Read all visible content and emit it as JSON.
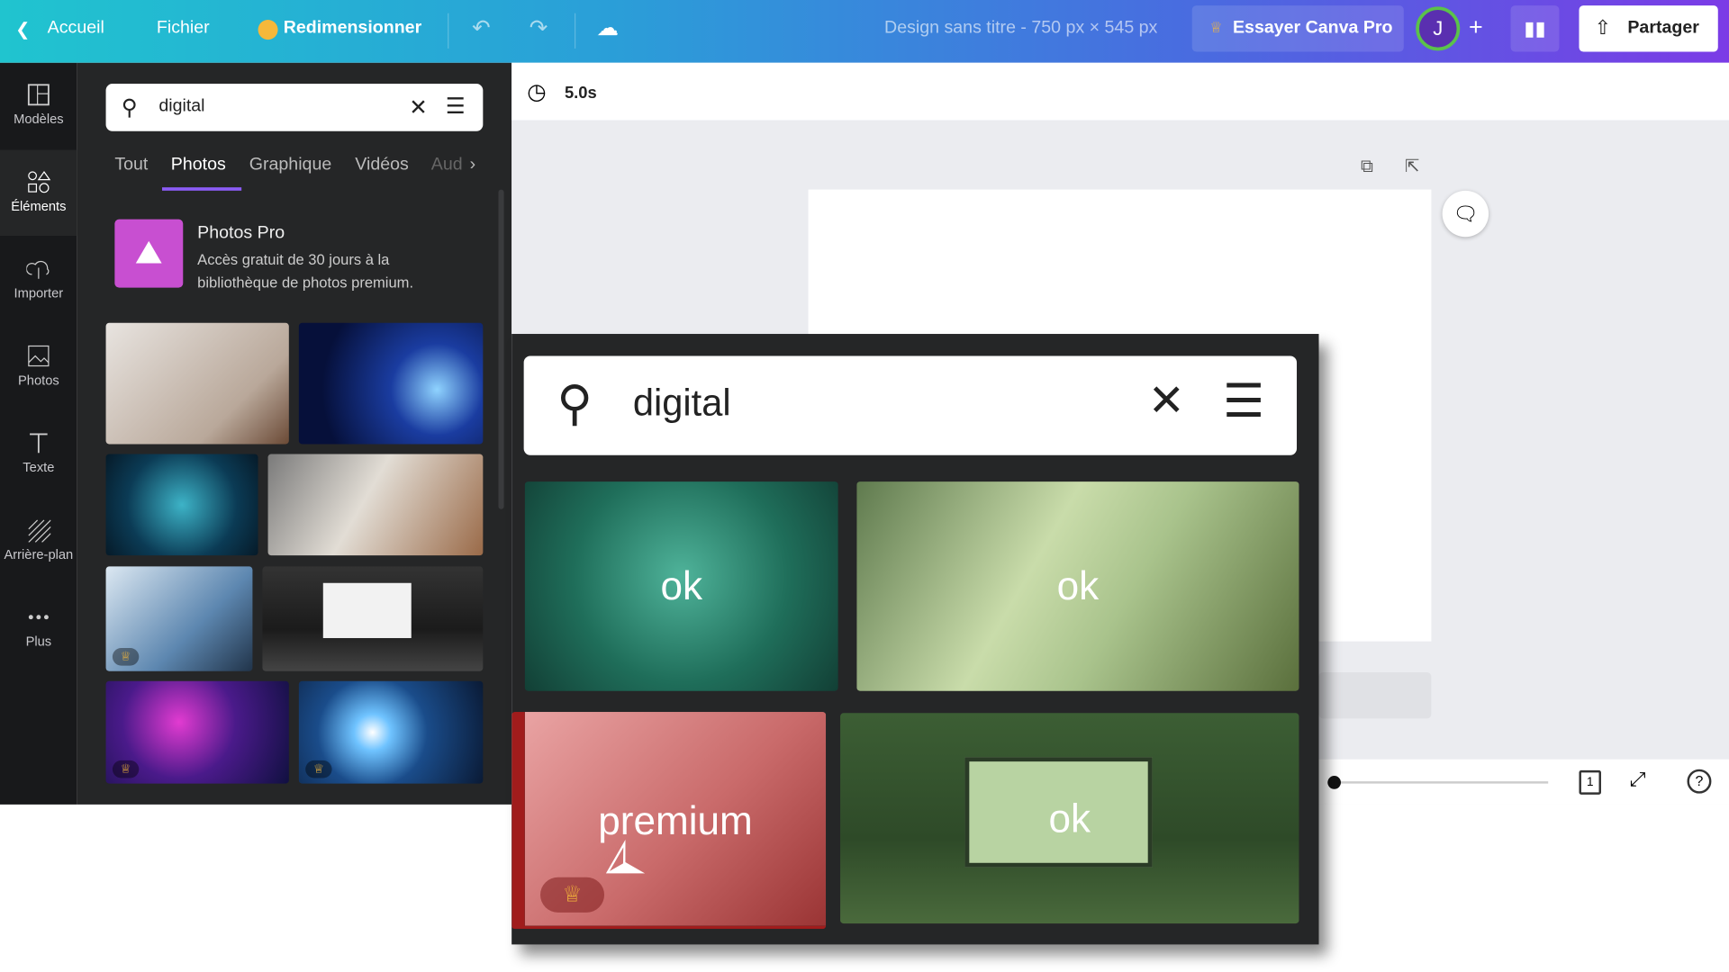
{
  "topbar": {
    "back": "Accueil",
    "file": "Fichier",
    "resize": "Redimensionner",
    "design_title": "Design sans titre - 750 px × 545 px",
    "try_pro": "Essayer Canva Pro",
    "avatar": "J",
    "share": "Partager"
  },
  "sidebar": {
    "items": [
      {
        "label": "Modèles",
        "icon": "templates-icon"
      },
      {
        "label": "Éléments",
        "icon": "elements-icon"
      },
      {
        "label": "Importer",
        "icon": "upload-icon"
      },
      {
        "label": "Photos",
        "icon": "photos-icon"
      },
      {
        "label": "Texte",
        "icon": "text-icon"
      },
      {
        "label": "Arrière-plan",
        "icon": "background-icon"
      },
      {
        "label": "Plus",
        "icon": "more-icon"
      }
    ]
  },
  "panel": {
    "search_value": "digital",
    "tabs": [
      "Tout",
      "Photos",
      "Graphique",
      "Vidéos",
      "Audio"
    ],
    "active_tab": "Photos",
    "promo_title": "Photos Pro",
    "promo_text": "Accès gratuit de 30 jours à la bibliothèque de photos premium."
  },
  "editor": {
    "duration": "5.0s",
    "page_number": "1"
  },
  "overlay": {
    "search_value": "digital",
    "labels": [
      "ok",
      "ok",
      "premium",
      "ok"
    ]
  },
  "colors": {
    "accent": "#8b5cf6",
    "pro_purple": "#c84fd1",
    "ok_green": "#3f7a3a",
    "premium_red": "#c0392b"
  }
}
